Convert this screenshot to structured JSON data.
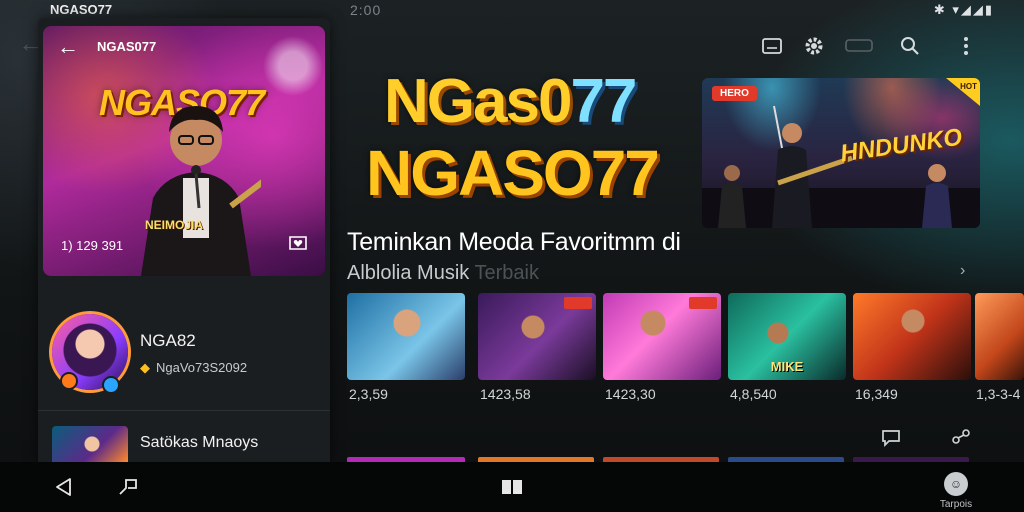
{
  "status_bar": {
    "title": "NGASO77",
    "time": "2:00",
    "icons": "✱ ▾◢◢▮"
  },
  "left_panel": {
    "hero": {
      "title": "NGAS077",
      "logo": "NGASO77",
      "subtitle": "NEIMOJIA",
      "count": "1) 129 391"
    },
    "artist": {
      "name": "NGA82",
      "meta": "NgaVo73S2092"
    },
    "playlist": {
      "name": "Satökas Mnaoys"
    }
  },
  "toolbar": {
    "icons": [
      "cast-icon",
      "gear-icon",
      "chat-icon",
      "search-icon",
      "more-icon"
    ]
  },
  "main": {
    "headline_line1_a": "NGas0",
    "headline_line1_b": "77",
    "headline_line2": "NGASO77",
    "banner": {
      "tag": "HERO",
      "corner": "HOT",
      "title": "HNDUNKO"
    },
    "tagline": "Teminkan Meoda Favoritmm di",
    "subtag_a": "Alblolia Musik ",
    "subtag_b": "Terbaik",
    "thumbnails": [
      {
        "count": "2,3,59",
        "label": ""
      },
      {
        "count": "1423,58",
        "label": ""
      },
      {
        "count": "1423,30",
        "label": ""
      },
      {
        "count": "4,8,540",
        "label": "MIKE"
      },
      {
        "count": "16,349",
        "label": ""
      },
      {
        "count": "1,3-3-4",
        "label": ""
      }
    ]
  },
  "nav": {
    "profile_label": "Tarpois"
  },
  "colors": {
    "accent": "#ffc51e",
    "tag_red": "#e23a2a",
    "background": "#121516"
  }
}
